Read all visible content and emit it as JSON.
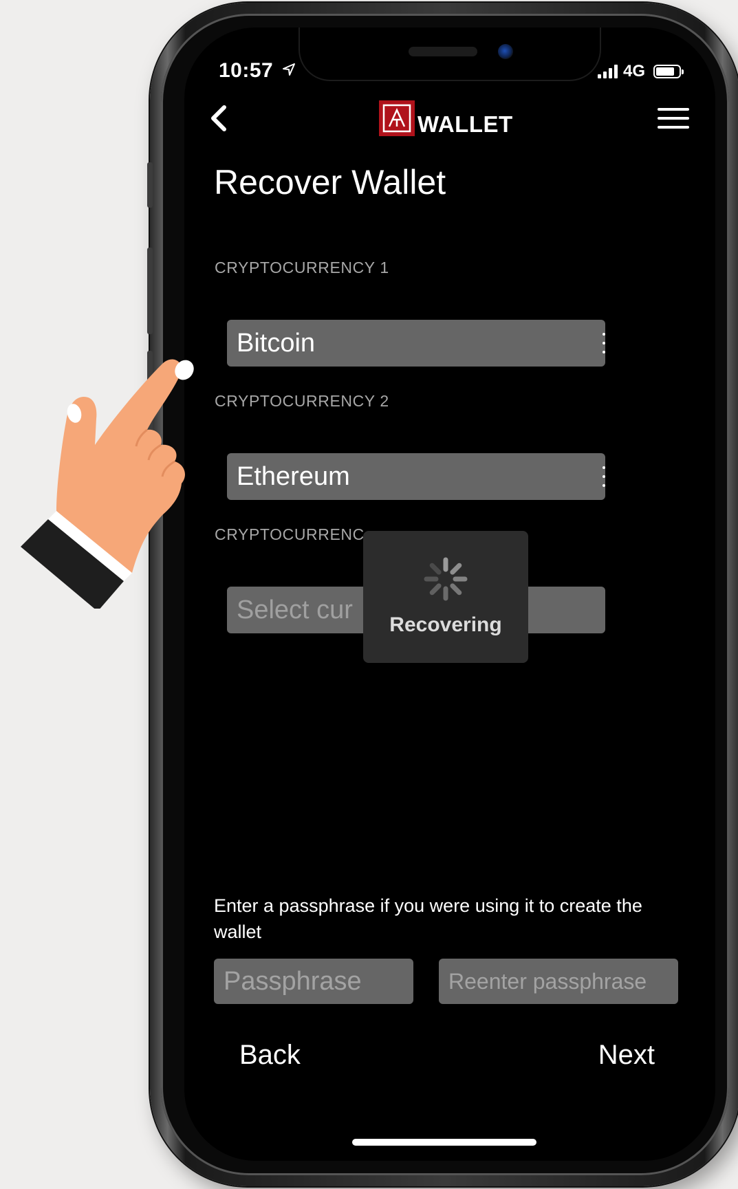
{
  "status_bar": {
    "time": "10:57",
    "network": "4G"
  },
  "header": {
    "logo_text": "WALLET"
  },
  "page": {
    "title": "Recover Wallet"
  },
  "currencies": [
    {
      "label": "CRYPTOCURRENCY 1",
      "value": "Bitcoin"
    },
    {
      "label": "CRYPTOCURRENCY 2",
      "value": "Ethereum"
    },
    {
      "label": "CRYPTOCURRENC",
      "placeholder": "Select cur"
    }
  ],
  "loading": {
    "text": "Recovering"
  },
  "passphrase": {
    "hint": "Enter a passphrase if you were using it to create the wallet",
    "placeholder": "Passphrase",
    "confirm_placeholder": "Reenter passphrase"
  },
  "footer": {
    "back_label": "Back",
    "next_label": "Next"
  },
  "colors": {
    "logo_red": "#b0121b",
    "field_bg": "#666666",
    "screen_bg": "#000000"
  }
}
